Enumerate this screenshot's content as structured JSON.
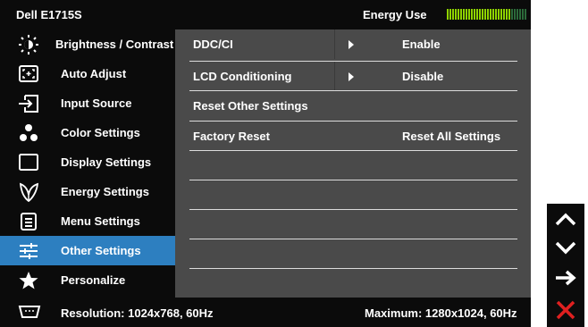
{
  "header": {
    "model": "Dell E1715S",
    "energy_label": "Energy Use"
  },
  "energy_meter": {
    "level": 0.8,
    "filled_color": "#8fd400",
    "empty_color": "#2c6a3a"
  },
  "menu": {
    "selected_index": 7,
    "items": [
      {
        "label": "Brightness / Contrast",
        "icon": "brightness-icon"
      },
      {
        "label": "Auto Adjust",
        "icon": "auto-adjust-icon"
      },
      {
        "label": "Input Source",
        "icon": "input-source-icon"
      },
      {
        "label": "Color Settings",
        "icon": "color-settings-icon"
      },
      {
        "label": "Display Settings",
        "icon": "display-settings-icon"
      },
      {
        "label": "Energy Settings",
        "icon": "leaf-icon"
      },
      {
        "label": "Menu Settings",
        "icon": "menu-settings-icon"
      },
      {
        "label": "Other Settings",
        "icon": "sliders-icon"
      },
      {
        "label": "Personalize",
        "icon": "star-icon"
      }
    ]
  },
  "settings": {
    "rows": [
      {
        "name": "DDC/CI",
        "value": "Enable",
        "has_arrow": true
      },
      {
        "name": "LCD Conditioning",
        "value": "Disable",
        "has_arrow": true
      },
      {
        "name": "Reset Other Settings",
        "value": "",
        "has_arrow": false
      },
      {
        "name": "Factory Reset",
        "value": "Reset All Settings",
        "has_arrow": false
      }
    ]
  },
  "footer": {
    "resolution": "Resolution: 1024x768, 60Hz",
    "maximum": "Maximum: 1280x1024, 60Hz",
    "icon": "vga-connector-icon"
  },
  "buttons": [
    {
      "name": "up-arrow-icon",
      "color": "#ffffff"
    },
    {
      "name": "down-arrow-icon",
      "color": "#ffffff"
    },
    {
      "name": "right-arrow-icon",
      "color": "#ffffff"
    },
    {
      "name": "close-icon",
      "color": "#e02020"
    }
  ],
  "colors": {
    "selected": "#2d7fc0",
    "panel": "#4a4a4a"
  }
}
